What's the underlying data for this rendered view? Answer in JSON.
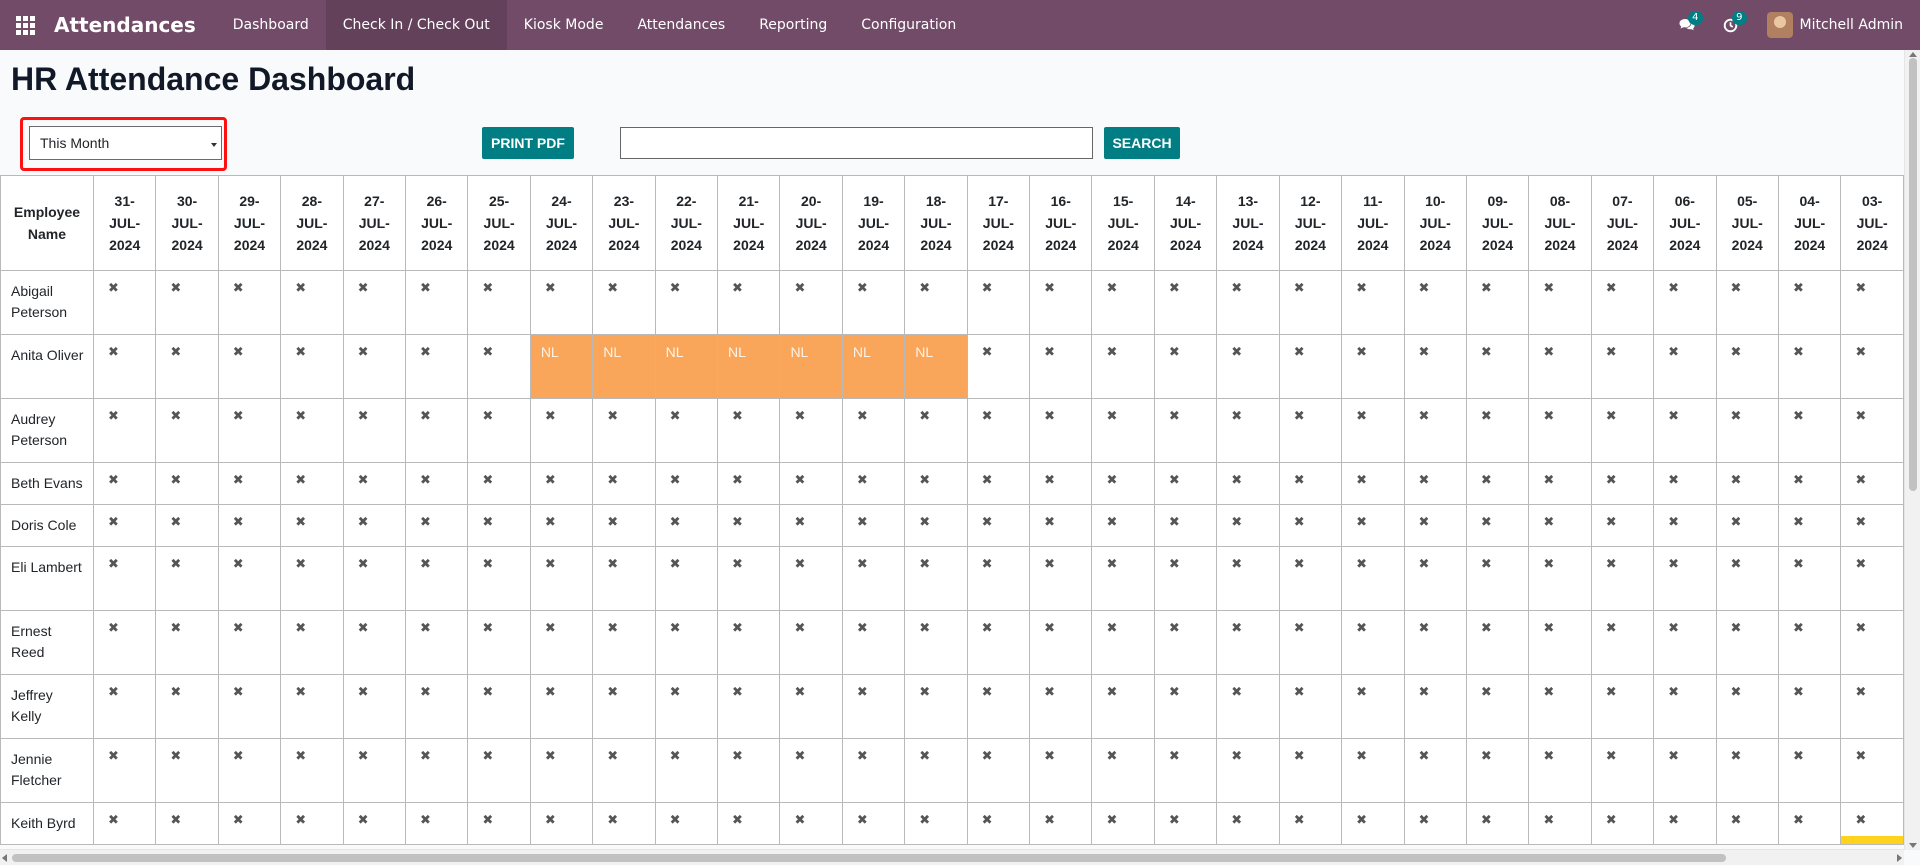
{
  "navbar": {
    "app_title": "Attendances",
    "menu": [
      "Dashboard",
      "Check In / Check Out",
      "Kiosk Mode",
      "Attendances",
      "Reporting",
      "Configuration"
    ],
    "active_menu_index": 1,
    "messages_badge": "4",
    "activities_badge": "9",
    "user_name": "Mitchell Admin",
    "icons": [
      "apps-grid-icon",
      "chat-icon",
      "clock-icon"
    ]
  },
  "page": {
    "title": "HR Attendance Dashboard",
    "period_select_value": "This Month",
    "print_button": "PRINT PDF",
    "search_value": "",
    "search_button": "SEARCH"
  },
  "table": {
    "name_header": "Employee Name",
    "dates": [
      "31-JUL-2024",
      "30-JUL-2024",
      "29-JUL-2024",
      "28-JUL-2024",
      "27-JUL-2024",
      "26-JUL-2024",
      "25-JUL-2024",
      "24-JUL-2024",
      "23-JUL-2024",
      "22-JUL-2024",
      "21-JUL-2024",
      "20-JUL-2024",
      "19-JUL-2024",
      "18-JUL-2024",
      "17-JUL-2024",
      "16-JUL-2024",
      "15-JUL-2024",
      "14-JUL-2024",
      "13-JUL-2024",
      "12-JUL-2024",
      "11-JUL-2024",
      "10-JUL-2024",
      "09-JUL-2024",
      "08-JUL-2024",
      "07-JUL-2024",
      "06-JUL-2024",
      "05-JUL-2024",
      "04-JUL-2024",
      "03-JUL-2024"
    ],
    "absent_mark": "✖",
    "leave_mark": "NL",
    "rows": [
      {
        "name": "Abigail Peterson",
        "leave_cols": []
      },
      {
        "name": "Anita Oliver",
        "leave_cols": [
          7,
          8,
          9,
          10,
          11,
          12,
          13
        ]
      },
      {
        "name": "Audrey Peterson",
        "leave_cols": []
      },
      {
        "name": "Beth Evans",
        "leave_cols": []
      },
      {
        "name": "Doris Cole",
        "leave_cols": []
      },
      {
        "name": "Eli Lambert",
        "leave_cols": []
      },
      {
        "name": "Ernest Reed",
        "leave_cols": []
      },
      {
        "name": "Jeffrey Kelly",
        "leave_cols": []
      },
      {
        "name": "Jennie Fletcher",
        "leave_cols": []
      },
      {
        "name": "Keith Byrd",
        "leave_cols": []
      }
    ],
    "colors": {
      "leave": "#f9a55a",
      "brand": "#714b67",
      "button": "#017e84",
      "highlight": "#ff1010"
    }
  }
}
